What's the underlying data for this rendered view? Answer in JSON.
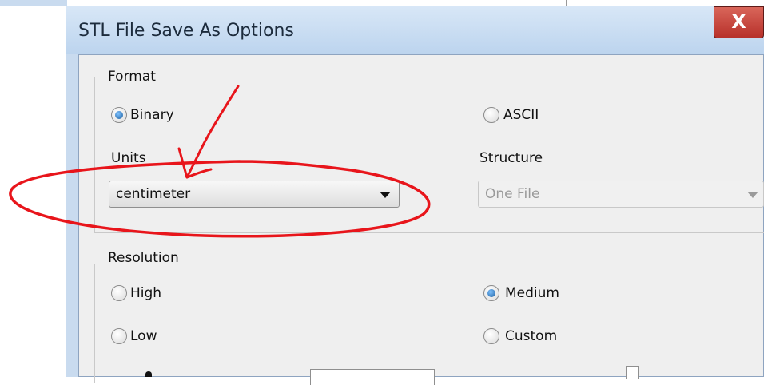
{
  "dialog": {
    "title": "STL File Save As Options",
    "close_label": "X"
  },
  "format": {
    "legend": "Format",
    "binary_label": "Binary",
    "ascii_label": "ASCII",
    "selected": "Binary",
    "units_label": "Units",
    "units_value": "centimeter",
    "structure_label": "Structure",
    "structure_value": "One File"
  },
  "resolution": {
    "legend": "Resolution",
    "high_label": "High",
    "medium_label": "Medium",
    "low_label": "Low",
    "custom_label": "Custom",
    "selected": "Medium"
  },
  "colors": {
    "annotation": "#e8151b",
    "title_bar": "#c9dbef",
    "close_button": "#c2453c"
  }
}
